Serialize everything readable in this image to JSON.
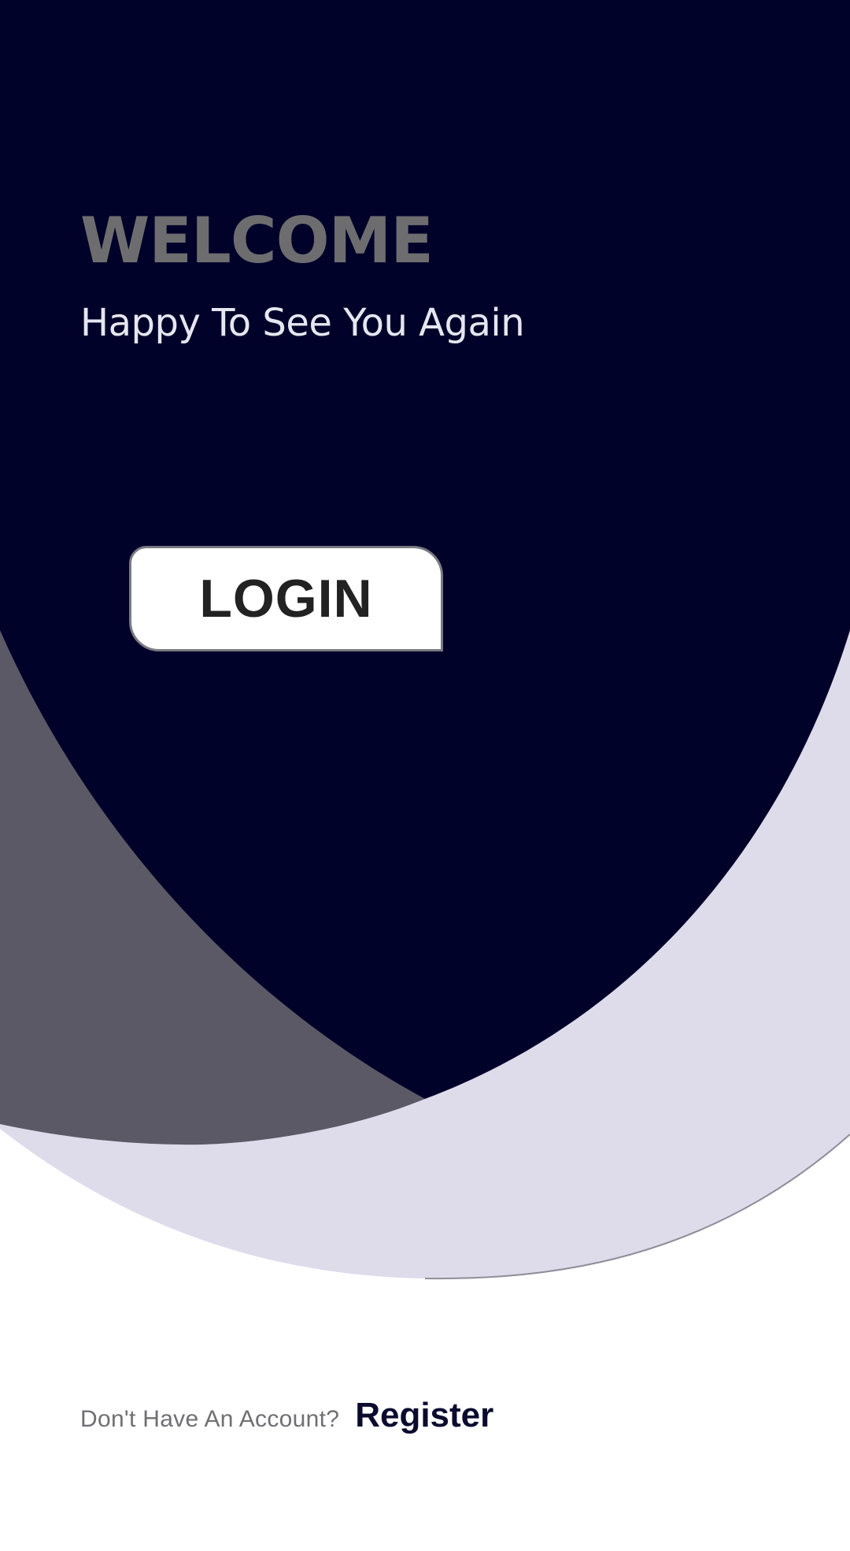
{
  "theme": {
    "navy": "#00022a",
    "gray_curve": "#5b5965",
    "lavender_curve": "#dedbeb",
    "background": "#ffffff",
    "title_color": "#6d6d6f",
    "subtitle_color": "#e6e6f0",
    "button_text_color": "#222222",
    "prompt_color": "#6f6f74",
    "register_color": "#0a0b2e"
  },
  "welcome": {
    "title": "WELCOME",
    "subtitle": "Happy To See You Again"
  },
  "login_button": {
    "label": "LOGIN"
  },
  "register": {
    "prompt": "Don't Have An Account?",
    "link_label": "Register"
  }
}
